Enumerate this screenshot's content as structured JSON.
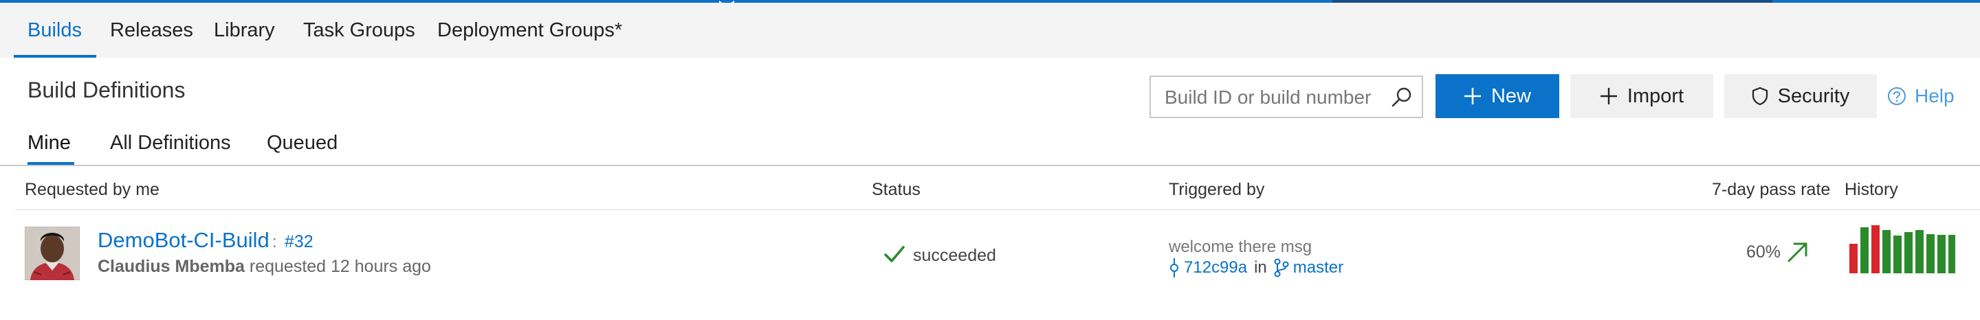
{
  "colors": {
    "accent": "#0a72c9",
    "success": "#2b8a2b",
    "failed": "#d9262a",
    "header_bg": "#f4f4f4"
  },
  "hub_tabs": [
    {
      "label": "Builds",
      "active": true
    },
    {
      "label": "Releases",
      "active": false
    },
    {
      "label": "Library",
      "active": false
    },
    {
      "label": "Task Groups",
      "active": false
    },
    {
      "label": "Deployment Groups*",
      "active": false
    }
  ],
  "page_title": "Build Definitions",
  "search": {
    "placeholder": "Build ID or build number",
    "value": "",
    "icon": "search-icon"
  },
  "toolbar": {
    "new_label": "New",
    "import_label": "Import",
    "security_label": "Security",
    "help_label": "Help"
  },
  "pivots": [
    {
      "label": "Mine",
      "active": true
    },
    {
      "label": "All Definitions",
      "active": false
    },
    {
      "label": "Queued",
      "active": false
    }
  ],
  "columns": {
    "requested": "Requested by me",
    "status": "Status",
    "triggered": "Triggered by",
    "pass_rate": "7-day pass rate",
    "history": "History"
  },
  "builds": [
    {
      "name": "DemoBot-CI-Build",
      "separator": ":",
      "number": "#32",
      "requester_name": "Claudius Mbemba",
      "requested_text": "requested 12 hours ago",
      "status": "succeeded",
      "status_icon": "check-icon",
      "trigger_message": "welcome there msg",
      "commit": "712c99a",
      "in_text": "in",
      "branch": "master",
      "pass_rate": "60%",
      "trend_icon": "arrow-up-right-icon",
      "history": [
        {
          "result": "failed",
          "relative_duration": 0.62
        },
        {
          "result": "succeeded",
          "relative_duration": 0.95
        },
        {
          "result": "failed",
          "relative_duration": 1.0
        },
        {
          "result": "succeeded",
          "relative_duration": 0.9
        },
        {
          "result": "succeeded",
          "relative_duration": 0.78
        },
        {
          "result": "succeeded",
          "relative_duration": 0.86
        },
        {
          "result": "succeeded",
          "relative_duration": 0.9
        },
        {
          "result": "succeeded",
          "relative_duration": 0.82
        },
        {
          "result": "succeeded",
          "relative_duration": 0.8
        },
        {
          "result": "succeeded",
          "relative_duration": 0.8
        }
      ]
    }
  ]
}
